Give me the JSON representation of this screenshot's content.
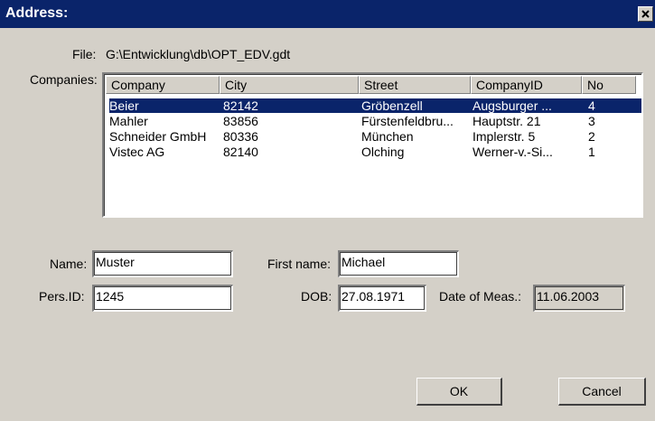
{
  "window": {
    "title": "Address:"
  },
  "file": {
    "label": "File:",
    "path": "G:\\Entwicklung\\db\\OPT_EDV.gdt"
  },
  "companies": {
    "label": "Companies:",
    "columns": [
      "Company",
      "City",
      "Street",
      "CompanyID",
      "No"
    ],
    "rows": [
      [
        "Beier",
        "82142",
        "Gröbenzell",
        "Augsburger ...",
        "4"
      ],
      [
        "Mahler",
        "83856",
        "Fürstenfeldbru...",
        "Hauptstr. 21",
        "3"
      ],
      [
        "Schneider GmbH",
        "80336",
        "München",
        "Implerstr. 5",
        "2"
      ],
      [
        "Vistec AG",
        "82140",
        "Olching",
        "Werner-v.-Si...",
        "1"
      ]
    ],
    "selected_row": 0
  },
  "form": {
    "name_label": "Name:",
    "name_value": "Muster",
    "first_name_label": "First name:",
    "first_name_value": "Michael",
    "pers_id_label": "Pers.ID:",
    "pers_id_value": "1245",
    "dob_label": "DOB:",
    "dob_value": "27.08.1971",
    "date_of_meas_label": "Date of Meas.:",
    "date_of_meas_value": "11.06.2003"
  },
  "buttons": {
    "ok": "OK",
    "cancel": "Cancel"
  },
  "colors": {
    "titlebar": "#0a246a",
    "selection": "#0a246a",
    "face": "#d4d0c8"
  },
  "icons": {
    "close": "close-icon"
  }
}
